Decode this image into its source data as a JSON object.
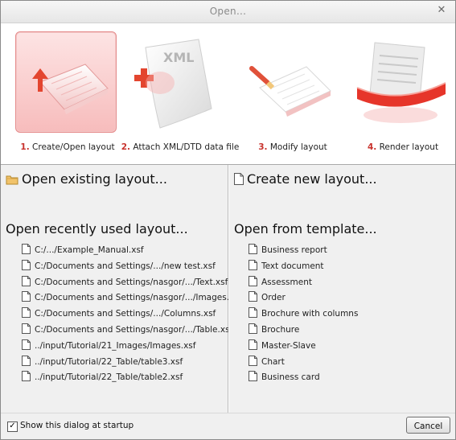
{
  "window": {
    "title": "Open..."
  },
  "steps": [
    {
      "num": "1.",
      "label": "Create/Open layout",
      "icon": "create-layout-icon",
      "selected": true
    },
    {
      "num": "2.",
      "label": "Attach XML/DTD data file",
      "icon": "attach-xml-icon",
      "xml_text": "XML"
    },
    {
      "num": "3.",
      "label": "Modify layout",
      "icon": "modify-layout-icon"
    },
    {
      "num": "4.",
      "label": "Render layout",
      "icon": "render-layout-icon"
    }
  ],
  "left": {
    "open_existing": "Open existing layout...",
    "recent_heading": "Open recently used layout...",
    "recent": [
      "C:/.../Example_Manual.xsf",
      "C:/Documents and Settings/.../new test.xsf",
      "C:/Documents and Settings/nasgor/.../Text.xsf",
      "C:/Documents and Settings/nasgor/.../Images.xsf",
      "C:/Documents and Settings/.../Columns.xsf",
      "C:/Documents and Settings/nasgor/.../Table.xsf",
      "../input/Tutorial/21_Images/Images.xsf",
      "../input/Tutorial/22_Table/table3.xsf",
      "../input/Tutorial/22_Table/table2.xsf"
    ]
  },
  "right": {
    "create_new": "Create new layout...",
    "template_heading": "Open from template...",
    "templates": [
      "Business report",
      "Text document",
      "Assessment",
      "Order",
      "Brochure with columns",
      "Brochure",
      "Master-Slave",
      "Chart",
      "Business card"
    ]
  },
  "footer": {
    "startup_label": "Show this dialog at startup",
    "startup_checked": true,
    "cancel_label": "Cancel"
  },
  "colors": {
    "accent_red": "#c8322d",
    "selected_bg": "#f7bcbc",
    "window_bg": "#f0f0f0"
  }
}
